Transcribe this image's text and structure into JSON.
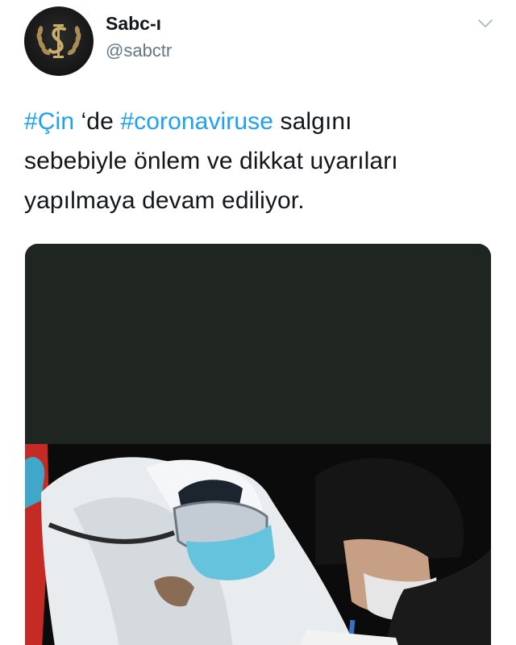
{
  "user": {
    "display_name": "Sabc-ı",
    "handle": "@sabctr"
  },
  "icons": {
    "avatar": "logo-avatar",
    "menu": "chevron-down-icon"
  },
  "tweet": {
    "line1": {
      "hashtag1": "#Çin",
      "text1": " ‘de ",
      "hashtag2": "#coronaviruse",
      "text2": " salgını"
    },
    "line2": "sebebiyle önlem ve dikkat uyarıları",
    "line3": "yapılmaya devam ediliyor."
  },
  "colors": {
    "hashtag": "#1da1f2",
    "text": "#14171a",
    "handle": "#657786",
    "media_top": "#1f2621"
  }
}
